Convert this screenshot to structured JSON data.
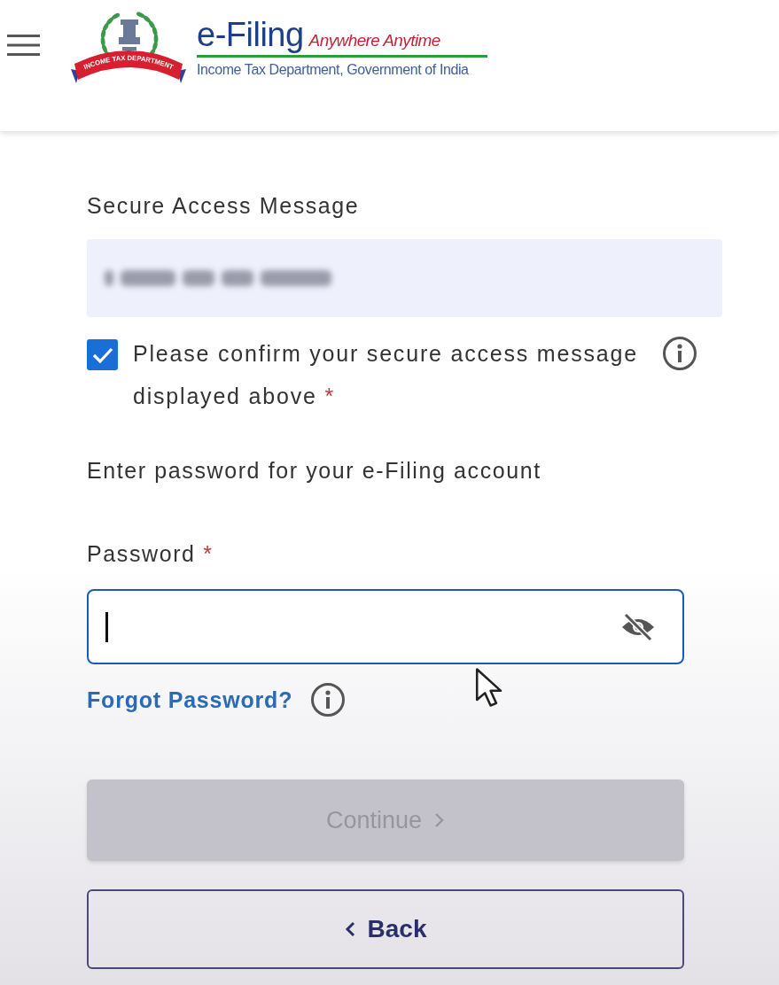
{
  "header": {
    "emblem_ribbon": "INCOME TAX DEPARTMENT",
    "title": "e-Filing",
    "tagline": "Anywhere Anytime",
    "subtitle": "Income Tax Department, Government of India"
  },
  "secure_access": {
    "label": "Secure Access Message",
    "blurred": true
  },
  "confirm": {
    "label": "Please confirm your secure access message displayed above",
    "required_mark": "*",
    "checked": true
  },
  "password_prompt": "Enter password for your e-Filing account",
  "password": {
    "label": "Password",
    "required_mark": "*",
    "focused": true
  },
  "forgot_password": "Forgot Password?",
  "buttons": [
    {
      "label": "Continue",
      "kind": "next",
      "disabled": true
    },
    {
      "label": "Back",
      "kind": "back",
      "disabled": false
    }
  ]
}
